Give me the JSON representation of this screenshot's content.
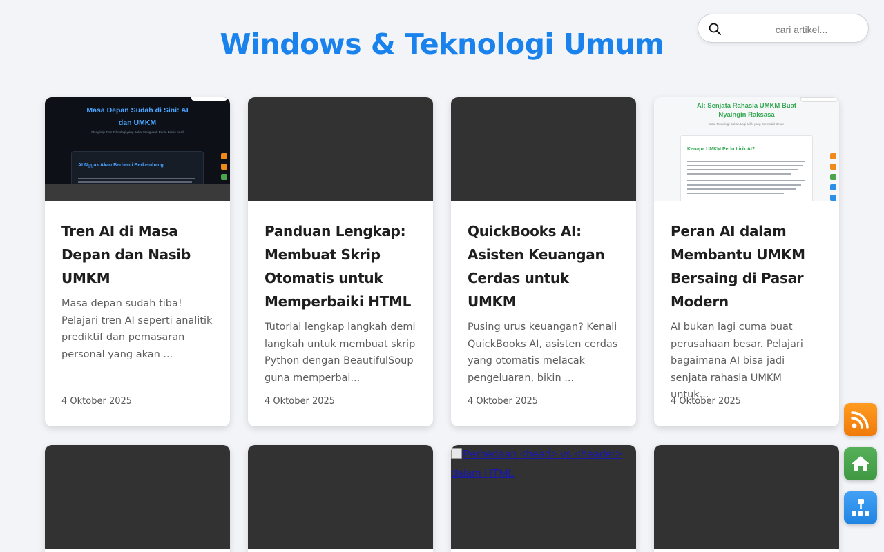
{
  "header": {
    "title": "Windows & Teknologi Umum"
  },
  "search": {
    "placeholder": "cari artikel..."
  },
  "cards": [
    {
      "title": "Tren AI di Masa Depan dan Nasib UMKM",
      "excerpt": "Masa depan sudah tiba! Pelajari tren AI seperti analitik prediktif dan pemasaran personal yang akan ...",
      "date": "4 Oktober 2025",
      "thumbnail": {
        "heading": "Masa Depan Sudah di Sini: AI dan UMKM",
        "subheading": "Mengintip Tren Teknologi yang Bakal Mengubah Dunia Bisnis Kecil",
        "box_heading": "AI Nggak Akan Berhenti Berkembang"
      }
    },
    {
      "title": "Panduan Lengkap: Membuat Skrip Otomatis untuk Memperbaiki HTML",
      "excerpt": "Tutorial lengkap langkah demi langkah untuk membuat skrip Python dengan BeautifulSoup guna memperbai...",
      "date": "4 Oktober 2025"
    },
    {
      "title": "QuickBooks AI: Asisten Keuangan Cerdas untuk UMKM",
      "excerpt": "Pusing urus keuangan? Kenali QuickBooks AI, asisten cerdas yang otomatis melacak pengeluaran, bikin ...",
      "date": "4 Oktober 2025"
    },
    {
      "title": "Peran AI dalam Membantu UMKM Bersaing di Pasar Modern",
      "excerpt": "AI bukan lagi cuma buat perusahaan besar. Pelajari bagaimana AI bisa jadi senjata rahasia UMKM untuk...",
      "date": "4 Oktober 2025",
      "thumbnail": {
        "heading": "AI: Senjata Rahasia UMKM Buat Nyaingin Raksasa",
        "subheading": "Saat Teknologi Bukan Lagi Milik yang Bermodal Besar",
        "box_heading": "Kenapa UMKM Perlu Lirik AI?"
      }
    }
  ],
  "row2": {
    "broken_image_alt": "Perbedaan <head> vs <header> dalam HTML"
  },
  "floating": {
    "rss_icon": "rss-icon",
    "home_icon": "home-icon",
    "sitemap_icon": "sitemap-icon"
  },
  "colors": {
    "accent": "#1a82ec",
    "rss": "#f7891a",
    "home": "#4aa54e",
    "sitemap": "#2b8fe8"
  }
}
